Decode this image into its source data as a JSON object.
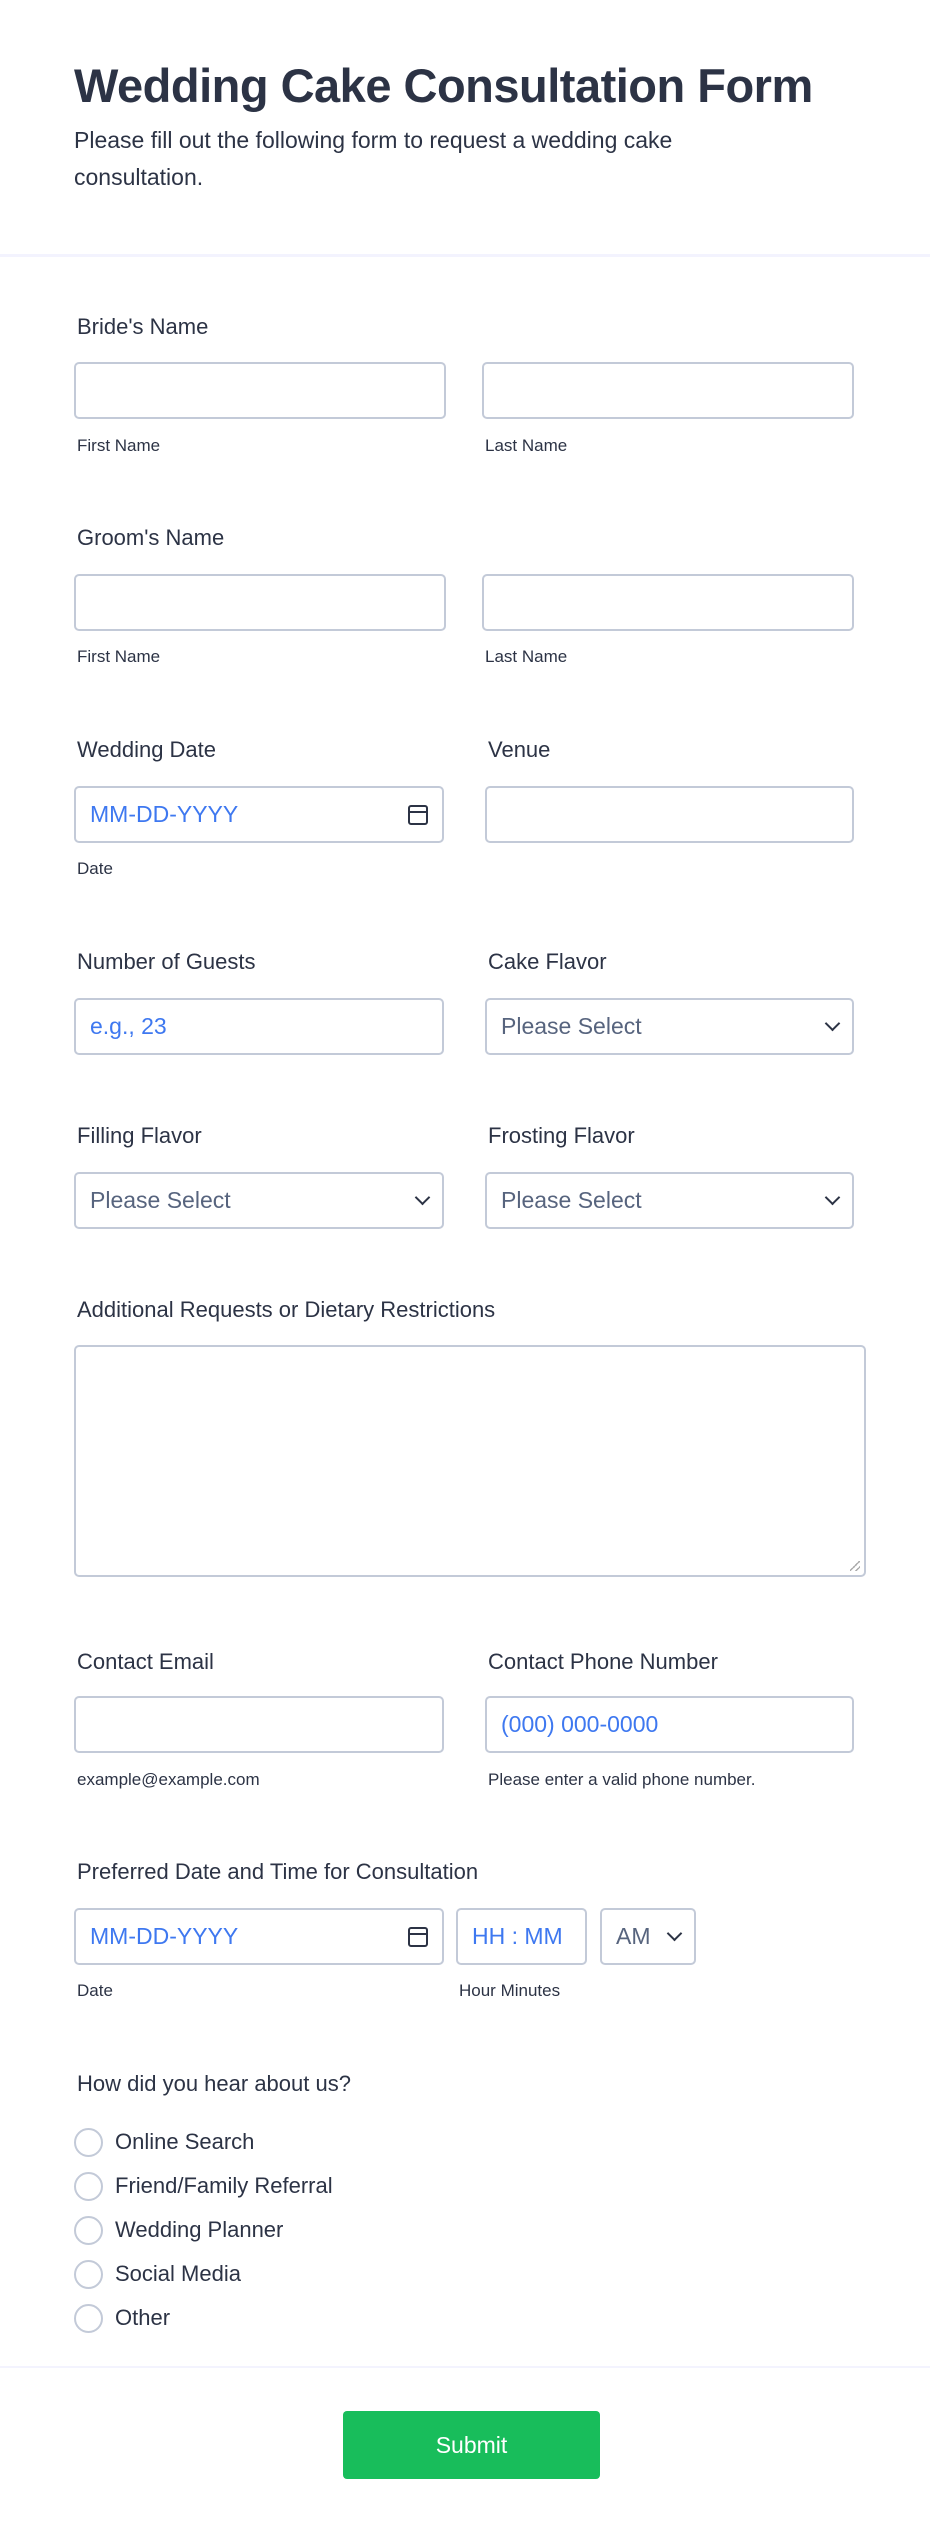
{
  "header": {
    "title": "Wedding Cake Consultation Form",
    "description": "Please fill out the following form to request a wedding cake consultation."
  },
  "brides_name": {
    "label": "Bride's Name",
    "first": "First Name",
    "last": "Last Name"
  },
  "grooms_name": {
    "label": "Groom's Name",
    "first": "First Name",
    "last": "Last Name"
  },
  "wedding_date": {
    "label": "Wedding Date",
    "placeholder": "MM-DD-YYYY",
    "sublabel": "Date"
  },
  "venue": {
    "label": "Venue"
  },
  "guests": {
    "label": "Number of Guests",
    "placeholder": "e.g., 23"
  },
  "cake_flavor": {
    "label": "Cake Flavor",
    "value": "Please Select"
  },
  "filling_flavor": {
    "label": "Filling Flavor",
    "value": "Please Select"
  },
  "frosting_flavor": {
    "label": "Frosting Flavor",
    "value": "Please Select"
  },
  "additional": {
    "label": "Additional Requests or Dietary Restrictions"
  },
  "email": {
    "label": "Contact Email",
    "sublabel": "example@example.com"
  },
  "phone": {
    "label": "Contact Phone Number",
    "placeholder": "(000) 000-0000",
    "sublabel": "Please enter a valid phone number."
  },
  "consultation": {
    "label": "Preferred Date and Time for Consultation",
    "date_placeholder": "MM-DD-YYYY",
    "date_sublabel": "Date",
    "time_placeholder": "HH : MM",
    "time_sublabel": "Hour Minutes",
    "ampm": "AM"
  },
  "referral": {
    "label": "How did you hear about us?",
    "options": [
      "Online Search",
      "Friend/Family Referral",
      "Wedding Planner",
      "Social Media",
      "Other"
    ]
  },
  "submit": {
    "label": "Submit",
    "color": "#18bd5b"
  },
  "colors": {
    "placeholder": "#3e78f0",
    "text": "#2c3345",
    "border": "#c3cad8"
  }
}
